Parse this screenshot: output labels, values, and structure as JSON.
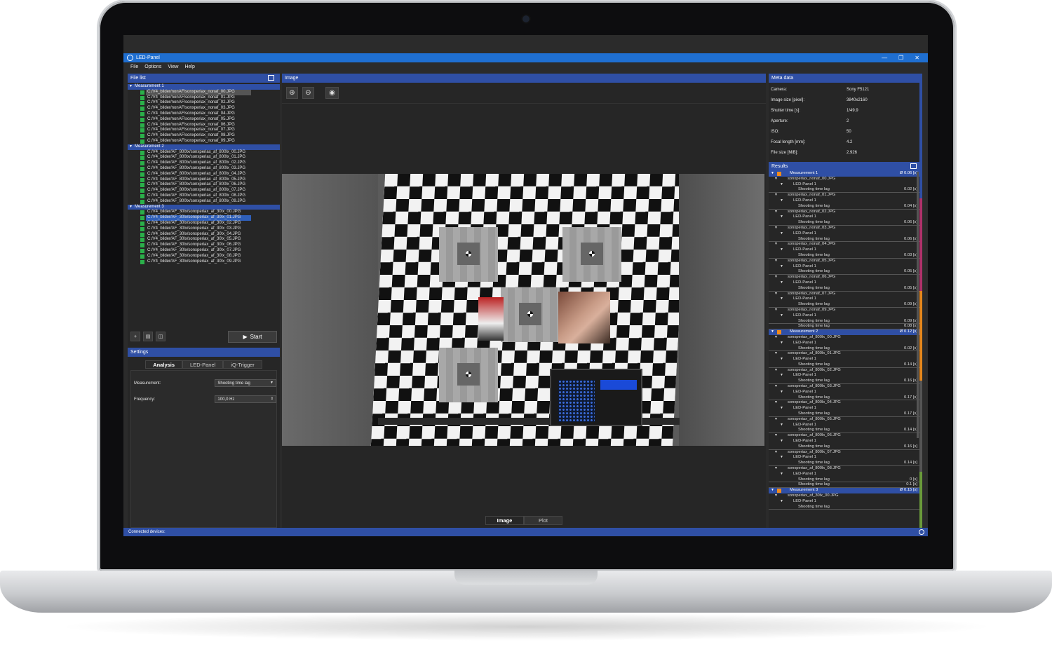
{
  "window": {
    "title": "LED-Panel",
    "controls": [
      "—",
      "❐",
      "✕"
    ]
  },
  "menu": [
    "File",
    "Options",
    "View",
    "Help"
  ],
  "file_list": {
    "title": "File list",
    "groups": [
      {
        "name": "Measurement 1",
        "files": [
          "C:/V4_bilder/nonAF/sonxperiax_nonaf_00.JPG",
          "C:/V4_bilder/nonAF/sonxperiax_nonaf_01.JPG",
          "C:/V4_bilder/nonAF/sonxperiax_nonaf_02.JPG",
          "C:/V4_bilder/nonAF/sonxperiax_nonaf_03.JPG",
          "C:/V4_bilder/nonAF/sonxperiax_nonaf_04.JPG",
          "C:/V4_bilder/nonAF/sonxperiax_nonaf_05.JPG",
          "C:/V4_bilder/nonAF/sonxperiax_nonaf_06.JPG",
          "C:/V4_bilder/nonAF/sonxperiax_nonaf_07.JPG",
          "C:/V4_bilder/nonAF/sonxperiax_nonaf_08.JPG",
          "C:/V4_bilder/nonAF/sonxperiax_nonaf_09.JPG"
        ]
      },
      {
        "name": "Measurement 2",
        "files": [
          "C:/V4_bilder/AF_800lx/sonxperiax_af_800lx_00.JPG",
          "C:/V4_bilder/AF_800lx/sonxperiax_af_800lx_01.JPG",
          "C:/V4_bilder/AF_800lx/sonxperiax_af_800lx_02.JPG",
          "C:/V4_bilder/AF_800lx/sonxperiax_af_800lx_03.JPG",
          "C:/V4_bilder/AF_800lx/sonxperiax_af_800lx_04.JPG",
          "C:/V4_bilder/AF_800lx/sonxperiax_af_800lx_05.JPG",
          "C:/V4_bilder/AF_800lx/sonxperiax_af_800lx_06.JPG",
          "C:/V4_bilder/AF_800lx/sonxperiax_af_800lx_07.JPG",
          "C:/V4_bilder/AF_800lx/sonxperiax_af_800lx_08.JPG",
          "C:/V4_bilder/AF_800lx/sonxperiax_af_800lx_09.JPG"
        ]
      },
      {
        "name": "Measurement 3",
        "files": [
          "C:/V4_bilder/AF_30lx/sonxperiax_af_30lx_00.JPG",
          "C:/V4_bilder/AF_30lx/sonxperiax_af_30lx_01.JPG",
          "C:/V4_bilder/AF_30lx/sonxperiax_af_30lx_02.JPG",
          "C:/V4_bilder/AF_30lx/sonxperiax_af_30lx_03.JPG",
          "C:/V4_bilder/AF_30lx/sonxperiax_af_30lx_04.JPG",
          "C:/V4_bilder/AF_30lx/sonxperiax_af_30lx_05.JPG",
          "C:/V4_bilder/AF_30lx/sonxperiax_af_30lx_06.JPG",
          "C:/V4_bilder/AF_30lx/sonxperiax_af_30lx_07.JPG",
          "C:/V4_bilder/AF_30lx/sonxperiax_af_30lx_08.JPG",
          "C:/V4_bilder/AF_30lx/sonxperiax_af_30lx_09.JPG"
        ]
      }
    ],
    "greyed_file": "C:/V4_bilder/nonAF/sonxperiax_nonaf_00.JPG",
    "selected_file": "C:/V4_bilder/AF_30lx/sonxperiax_af_30lx_01.JPG"
  },
  "toolbar": {
    "start_label": "Start",
    "start_icon": "▶"
  },
  "settings": {
    "title": "Settings",
    "tabs": [
      "Analysis",
      "LED-Panel",
      "iQ-Trigger"
    ],
    "active_tab": "Analysis",
    "measurement_label": "Measurement:",
    "measurement_value": "Shooting time lag",
    "frequency_label": "Frequency:",
    "frequency_value": "100,0 Hz"
  },
  "image_panel": {
    "title": "Image",
    "bottom_tabs": [
      "Image",
      "Plot"
    ],
    "active_tab": "Image"
  },
  "meta": {
    "title": "Meta data",
    "rows": [
      {
        "k": "Camera:",
        "v": "Sony F5121"
      },
      {
        "k": "Image size [pixel]:",
        "v": "3840x2160"
      },
      {
        "k": "Shutter time [s]:",
        "v": "1/49.9"
      },
      {
        "k": "Aperture:",
        "v": "2"
      },
      {
        "k": "ISO:",
        "v": "50"
      },
      {
        "k": "Focal length [mm]:",
        "v": "4.2"
      },
      {
        "k": "File size [MiB]:",
        "v": "2.926"
      }
    ]
  },
  "results": {
    "title": "Results",
    "led_label": "LED-Panel 1",
    "lag_label": "Shooting time lag",
    "groups": [
      {
        "name": "Measurement 1",
        "avg": "Ø 0.06 [s]",
        "files": [
          {
            "name": "sonxperiax_nonaf_00.JPG",
            "value": "0.02 [s]"
          },
          {
            "name": "sonxperiax_nonaf_01.JPG",
            "value": "0.04 [s]"
          },
          {
            "name": "sonxperiax_nonaf_02.JPG",
            "value": "0.06 [s]"
          },
          {
            "name": "sonxperiax_nonaf_03.JPG",
            "value": "0.06 [s]"
          },
          {
            "name": "sonxperiax_nonaf_04.JPG",
            "value": "0.03 [s]"
          },
          {
            "name": "sonxperiax_nonaf_05.JPG",
            "value": "0.05 [s]"
          },
          {
            "name": "sonxperiax_nonaf_06.JPG",
            "value": "0.05 [s]"
          },
          {
            "name": "sonxperiax_nonaf_07.JPG",
            "value": "0.09 [s]"
          },
          {
            "name": "sonxperiax_nonaf_09.JPG",
            "value": "0.09 [s]"
          }
        ],
        "extra_value": "0.08 [s]"
      },
      {
        "name": "Measurement 2",
        "avg": "Ø 0.12 [s]",
        "files": [
          {
            "name": "sonxperiax_af_800lx_00.JPG",
            "value": "0.02 [s]"
          },
          {
            "name": "sonxperiax_af_800lx_01.JPG",
            "value": "0.14 [s]"
          },
          {
            "name": "sonxperiax_af_800lx_02.JPG",
            "value": "0.16 [s]"
          },
          {
            "name": "sonxperiax_af_800lx_03.JPG",
            "value": "0.17 [s]"
          },
          {
            "name": "sonxperiax_af_800lx_04.JPG",
            "value": "0.17 [s]"
          },
          {
            "name": "sonxperiax_af_800lx_05.JPG",
            "value": "0.14 [s]"
          },
          {
            "name": "sonxperiax_af_800lx_06.JPG",
            "value": "0.16 [s]"
          },
          {
            "name": "sonxperiax_af_800lx_07.JPG",
            "value": "0.14 [s]"
          },
          {
            "name": "sonxperiax_af_800lx_08.JPG",
            "value": "0 [s]"
          }
        ],
        "extra_value": "0.1 [s]"
      },
      {
        "name": "Measurement 3",
        "avg": "Ø 0.15 [s]",
        "files": [
          {
            "name": "sonxperiax_af_30lx_00.JPG",
            "value": ""
          }
        ],
        "extra_value": ""
      }
    ]
  },
  "statusbar": {
    "text": "Connected devices:"
  },
  "colors": {
    "accent": "#2f4fa5",
    "titlebar": "#1f6fd1",
    "check": "#2bb04a",
    "group_marker": "#f08a1a"
  }
}
